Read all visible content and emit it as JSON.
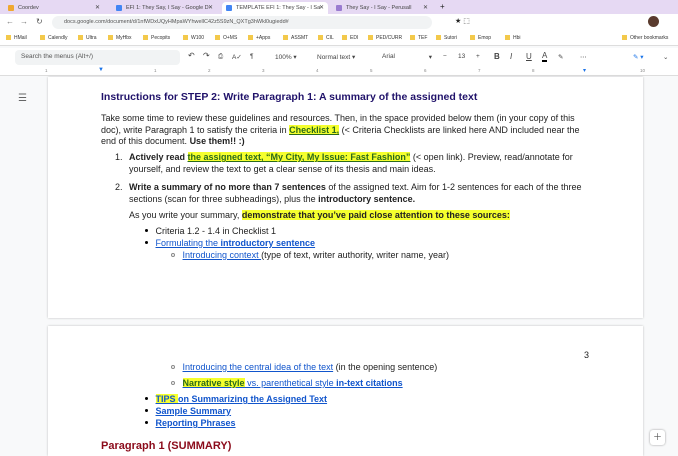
{
  "browser": {
    "tabs": [
      {
        "title": "Coordev",
        "color": "#f0a830"
      },
      {
        "title": "EFI 1: They Say, I Say - Google D",
        "color": "#4285f4"
      },
      {
        "title": "TEMPLATE EFI 1: They Say - I Sa",
        "color": "#4285f4"
      },
      {
        "title": "They Say - I Say - Perusall",
        "color": "#9a7bd0"
      }
    ],
    "url": "docs.google.com/document/d/1nfWDxUQyHMpaWYhwellC42z5S9zN_QXTg3hWkl0ugiedd#",
    "bookmarks": [
      "HMail",
      "Calendly",
      "Ultra",
      "MyHbx",
      "Pecopits",
      "W100",
      "O+MS",
      "+Apps",
      "ASSMT",
      "CIL",
      "EDI",
      "PED/CURR",
      "TEF",
      "Sutori",
      "Emop",
      "Hbi"
    ],
    "other_bookmarks": "Other bookmarks"
  },
  "toolbar": {
    "search_placeholder": "Search the menus (Alt+/)",
    "zoom": "100%",
    "style": "Normal text",
    "font": "Arial",
    "size": "13",
    "bold": "B",
    "italic": "I",
    "underline": "U",
    "color": "A",
    "more": "⋯"
  },
  "ruler": [
    "1",
    "1",
    "2",
    "3",
    "4",
    "5",
    "6",
    "7",
    "8",
    "10"
  ],
  "doc": {
    "heading": "Instructions for STEP 2: Write Paragraph 1: A summary of the assigned text",
    "p1a": "Take some time to review these guidelines and resources. Then, in the space provided below them (in your copy of this",
    "p1b": "doc), write Paragraph 1 to satisfy the criteria in ",
    "p1link": "Checklist 1,",
    "p1c": " (< Criteria Checklists are linked here AND included near the",
    "p1d": "end of this document. ",
    "p1bold": "Use them!! :)",
    "i1num": "1.",
    "i1bold": "Actively read ",
    "i1link": "the assigned text, “My City, My Issue: Fast Fashion”",
    "i1a": " (< open link). Preview, read/annotate for",
    "i1b": "yourself, and review the text to get a clear sense of its thesis and main ideas.",
    "i2num": "2.",
    "i2bold": "Write a summary of no more than 7 sentences",
    "i2a": " of the assigned text. Aim for 1-2 sentences for each of the three",
    "i2b": "sections (scan for three subheadings), plus the ",
    "i2bold2": "introductory sentence.",
    "p2": "As you write your summary, ",
    "p2hl": "demonstrate that you’ve paid close attention to these sources:",
    "b1": "Criteria 1.2 - 1.4 in Checklist 1",
    "b2a": "Formulating the ",
    "b2b": "introductory sentence",
    "s1link": "Introducing context ",
    "s1": "(type of text, writer authority, writer name, year)",
    "page_num": "3",
    "s2link": "Introducing the central idea of the text",
    "s2": " (in the opening sentence)",
    "s3a": "Narrative style",
    "s3b": " vs. parenthetical style ",
    "s3c": "in-text citations",
    "b3a": "TIPS ",
    "b3b": "on Summarizing the Assigned Text",
    "b4": "Sample Summary",
    "b5": "Reporting Phrases",
    "heading2": "Paragraph 1 (SUMMARY)"
  }
}
